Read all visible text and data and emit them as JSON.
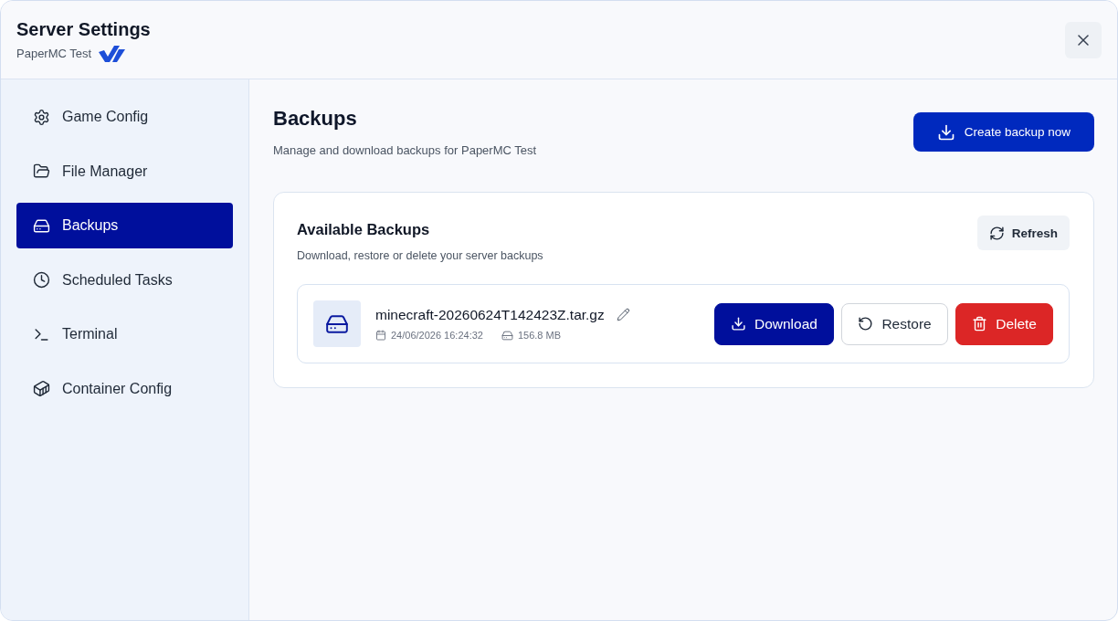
{
  "dialog": {
    "title": "Server Settings",
    "subtitle": "PaperMC Test"
  },
  "sidebar": {
    "items": [
      {
        "label": "Game Config",
        "selected": false
      },
      {
        "label": "File Manager",
        "selected": false
      },
      {
        "label": "Backups",
        "selected": true
      },
      {
        "label": "Scheduled Tasks",
        "selected": false
      },
      {
        "label": "Terminal",
        "selected": false
      },
      {
        "label": "Container Config",
        "selected": false
      }
    ]
  },
  "main": {
    "title": "Backups",
    "subtitle": "Manage and download backups for PaperMC Test",
    "create_button": "Create backup now"
  },
  "card": {
    "title": "Available Backups",
    "subtitle": "Download, restore or delete your server backups",
    "refresh_button": "Refresh",
    "backups": [
      {
        "name": "minecraft-20260624T142423Z.tar.gz",
        "date": "24/06/2026 16:24:32",
        "size": "156.8 MB",
        "actions": [
          {
            "label": "Download",
            "kind": "primary"
          },
          {
            "label": "Restore",
            "kind": "outline"
          },
          {
            "label": "Delete",
            "kind": "danger"
          }
        ]
      }
    ]
  }
}
